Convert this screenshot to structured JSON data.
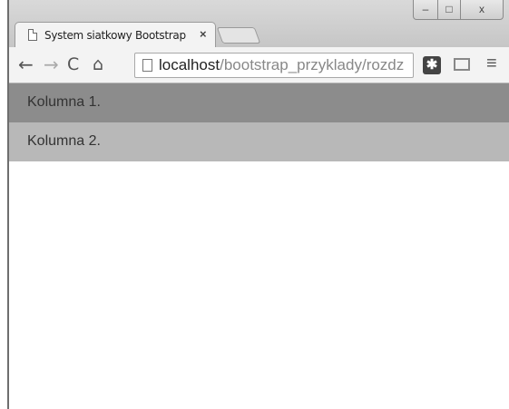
{
  "window": {
    "tab_title": "System siatkowy Bootstrap",
    "tab_close": "×",
    "controls": {
      "minimize": "–",
      "maximize": "□",
      "close": "x"
    }
  },
  "toolbar": {
    "back": "←",
    "forward": "→",
    "reload": "C",
    "home": "⌂",
    "url_host": "localhost",
    "url_path": "/bootstrap_przyklady/rozdz",
    "extension": "✱",
    "menu": "≡"
  },
  "page": {
    "column1": "Kolumna 1.",
    "column2": "Kolumna 2."
  }
}
